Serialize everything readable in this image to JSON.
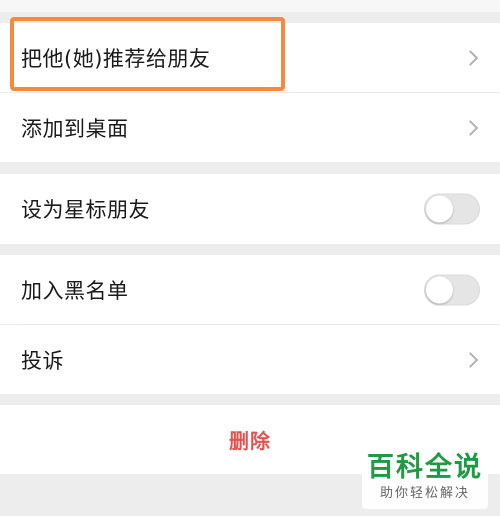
{
  "menu": {
    "recommend_label": "把他(她)推荐给朋友",
    "add_desktop_label": "添加到桌面",
    "star_friend_label": "设为星标朋友",
    "star_friend_enabled": false,
    "blacklist_label": "加入黑名单",
    "blacklist_enabled": false,
    "complain_label": "投诉",
    "delete_label": "删除"
  },
  "watermark": {
    "title": "百科全说",
    "subtitle": "助你轻松解决"
  },
  "colors": {
    "highlight": "#f58a3f",
    "delete_text": "#e25353",
    "watermark_green": "#1c9b42"
  }
}
